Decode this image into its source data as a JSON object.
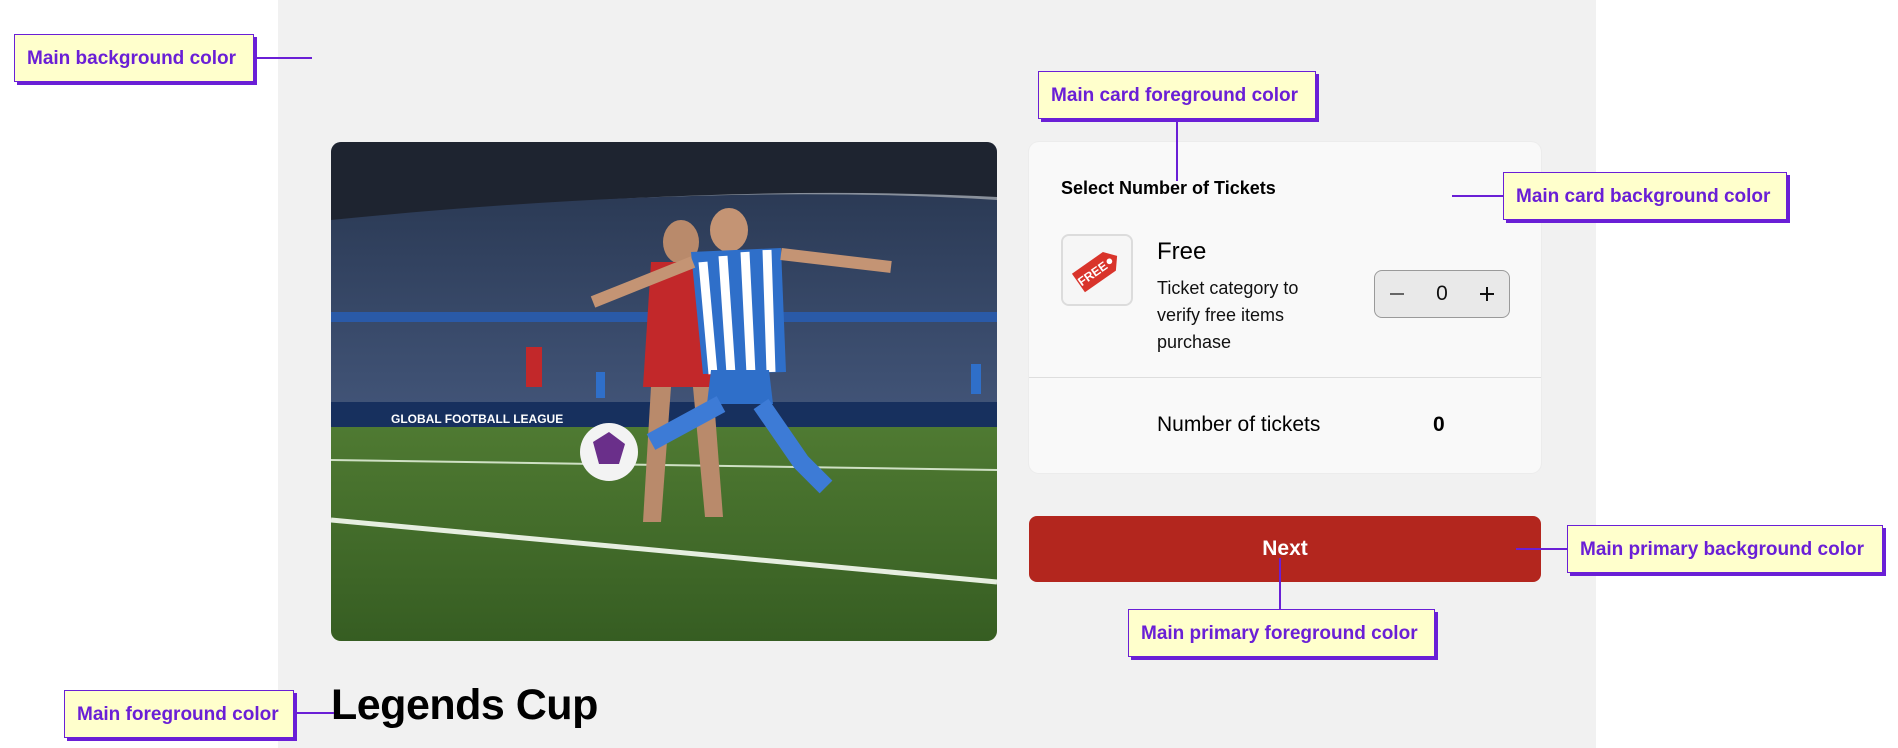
{
  "event": {
    "title": "Legends Cup",
    "image_alt": "Football players contesting the ball in a stadium"
  },
  "ticket_card": {
    "heading": "Select Number of Tickets",
    "ticket": {
      "name": "Free",
      "description": "Ticket category to verify free items purchase",
      "thumb_icon": "free-tag-icon",
      "thumb_text": "FREE",
      "quantity": "0"
    },
    "summary": {
      "label": "Number of tickets",
      "value": "0"
    }
  },
  "primary_button": {
    "label": "Next"
  },
  "annotations": {
    "main_background": "Main background color",
    "card_foreground": "Main card foreground color",
    "card_background": "Main card background color",
    "primary_background": "Main primary background color",
    "primary_foreground": "Main primary foreground color",
    "main_foreground": "Main foreground color"
  },
  "colors": {
    "main_background": "#f1f1f1",
    "card_background": "#f9f9f9",
    "primary": "#b3261e",
    "primary_foreground": "#ffffff",
    "foreground": "#000000",
    "annotation_border": "#6a1fd6",
    "annotation_fill": "#ffffcc"
  },
  "icons": {
    "minus": "minus-icon",
    "plus": "plus-icon"
  }
}
